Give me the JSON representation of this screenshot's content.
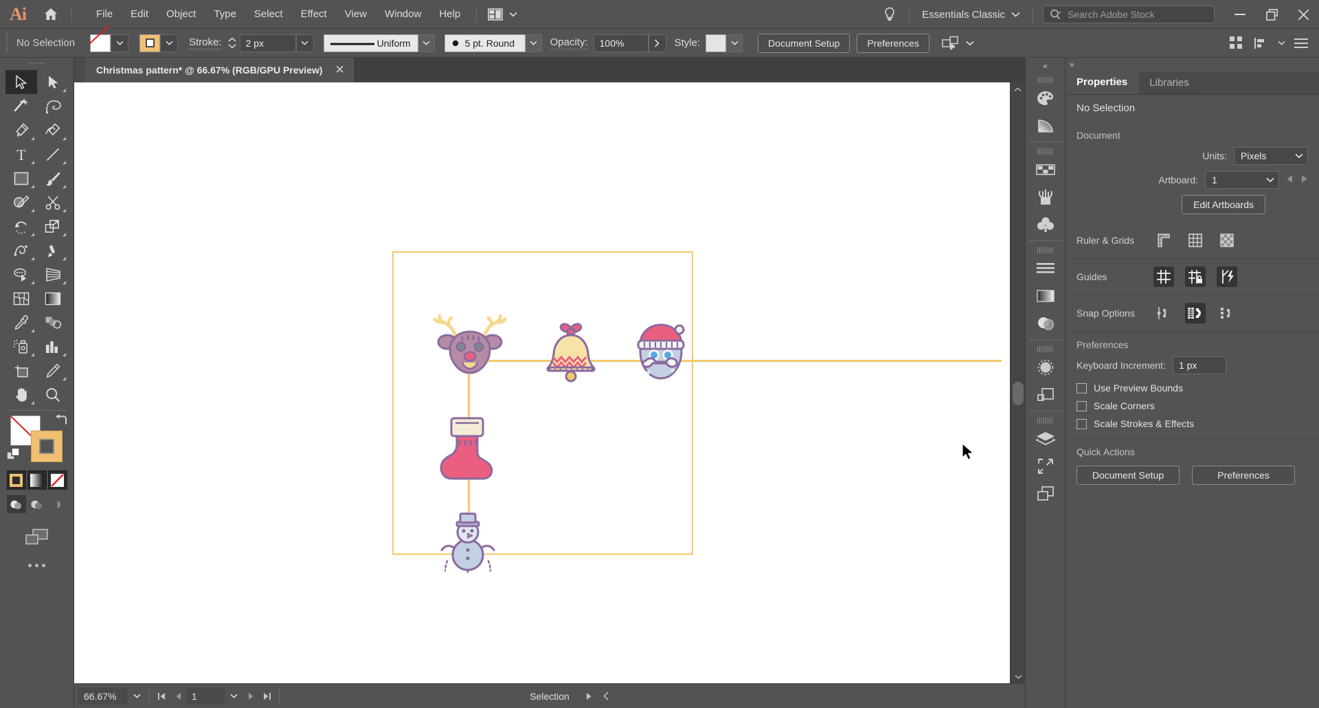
{
  "app": {
    "name": "Ai",
    "logo_color": "#e8956b"
  },
  "menubar": {
    "home_icon": "home-icon",
    "items": [
      "File",
      "Edit",
      "Object",
      "Type",
      "Select",
      "Effect",
      "View",
      "Window",
      "Help"
    ],
    "arrange_icon": "arrange-documents-icon",
    "bulb_icon": "discover-bulb-icon",
    "workspace": "Essentials Classic",
    "search": {
      "placeholder": "Search Adobe Stock",
      "value": "",
      "icon": "search-icon"
    },
    "window_controls": [
      "minimize",
      "restore",
      "close"
    ]
  },
  "controlbar": {
    "selection_status": "No Selection",
    "fill_swatch": "none-fill",
    "stroke_swatch": "#f0c070",
    "stroke_label": "Stroke:",
    "stroke_weight": "2 px",
    "stroke_profile": "Uniform",
    "brush_definition": "5 pt. Round",
    "opacity_label": "Opacity:",
    "opacity_value": "100%",
    "style_label": "Style:",
    "document_setup": "Document Setup",
    "preferences": "Preferences",
    "align_icon": "align-to-icon"
  },
  "toolbar": {
    "tools": [
      {
        "name": "selection-tool",
        "glyph": "selection",
        "active": true,
        "more": false
      },
      {
        "name": "direct-selection-tool",
        "glyph": "direct-selection",
        "active": false,
        "more": true
      },
      {
        "name": "magic-wand-tool",
        "glyph": "magic-wand",
        "active": false,
        "more": false
      },
      {
        "name": "lasso-tool",
        "glyph": "lasso",
        "active": false,
        "more": false
      },
      {
        "name": "pen-tool",
        "glyph": "pen",
        "active": false,
        "more": true
      },
      {
        "name": "curvature-tool",
        "glyph": "curvature",
        "active": false,
        "more": true
      },
      {
        "name": "type-tool",
        "glyph": "type",
        "active": false,
        "more": true
      },
      {
        "name": "line-segment-tool",
        "glyph": "line",
        "active": false,
        "more": true
      },
      {
        "name": "rectangle-tool",
        "glyph": "rectangle",
        "active": false,
        "more": true
      },
      {
        "name": "paintbrush-tool",
        "glyph": "paintbrush",
        "active": false,
        "more": true
      },
      {
        "name": "shaper-tool",
        "glyph": "shaper",
        "active": false,
        "more": true
      },
      {
        "name": "scissors-tool",
        "glyph": "scissors",
        "active": false,
        "more": true
      },
      {
        "name": "rotate-tool",
        "glyph": "rotate",
        "active": false,
        "more": true
      },
      {
        "name": "scale-tool",
        "glyph": "scale",
        "active": false,
        "more": true
      },
      {
        "name": "width-tool",
        "glyph": "width",
        "active": false,
        "more": true
      },
      {
        "name": "free-transform-tool",
        "glyph": "free-transform",
        "active": false,
        "more": true
      },
      {
        "name": "shape-builder-tool",
        "glyph": "shape-builder",
        "active": false,
        "more": true
      },
      {
        "name": "perspective-grid-tool",
        "glyph": "perspective-grid",
        "active": false,
        "more": true
      },
      {
        "name": "mesh-tool",
        "glyph": "mesh",
        "active": false,
        "more": false
      },
      {
        "name": "gradient-tool",
        "glyph": "gradient",
        "active": false,
        "more": false
      },
      {
        "name": "eyedropper-tool",
        "glyph": "eyedropper",
        "active": false,
        "more": true
      },
      {
        "name": "blend-tool",
        "glyph": "blend",
        "active": false,
        "more": false
      },
      {
        "name": "symbol-sprayer-tool",
        "glyph": "symbol-sprayer",
        "active": false,
        "more": true
      },
      {
        "name": "column-graph-tool",
        "glyph": "column-graph",
        "active": false,
        "more": true
      },
      {
        "name": "artboard-tool",
        "glyph": "artboard",
        "active": false,
        "more": false
      },
      {
        "name": "slice-tool",
        "glyph": "slice",
        "active": false,
        "more": true
      },
      {
        "name": "hand-tool",
        "glyph": "hand",
        "active": false,
        "more": true
      },
      {
        "name": "zoom-tool",
        "glyph": "zoom",
        "active": false,
        "more": false
      }
    ],
    "fill_color": "none",
    "stroke_color": "#f0c070",
    "swap_icon": "swap-fill-stroke-icon",
    "default_icon": "default-fill-stroke-icon",
    "color_modes": [
      "color-mode",
      "gradient-mode",
      "none-mode"
    ],
    "draw_modes": [
      "draw-normal",
      "draw-behind",
      "draw-inside"
    ],
    "screen_mode_icon": "change-screen-mode-icon",
    "edit_toolbar_icon": "edit-toolbar-icon"
  },
  "document": {
    "tab_title": "Christmas pattern* @ 66.67% (RGB/GPU Preview)",
    "close_icon": "close-tab-icon"
  },
  "canvas": {
    "artboard_border_color": "#f5c86a",
    "path_color": "#f5c86a",
    "artwork": [
      {
        "name": "reindeer-head",
        "label": "reindeer"
      },
      {
        "name": "christmas-bell",
        "label": "bell"
      },
      {
        "name": "santa-face",
        "label": "santa"
      },
      {
        "name": "christmas-stocking",
        "label": "stocking"
      },
      {
        "name": "snowman",
        "label": "snowman"
      }
    ],
    "cursor": "arrow-cursor"
  },
  "statusbar": {
    "zoom": "66.67%",
    "artboard_number": "1",
    "status_text": "Selection",
    "first_icon": "first-artboard-icon",
    "prev_icon": "previous-artboard-icon",
    "next_icon": "next-artboard-icon",
    "last_icon": "last-artboard-icon"
  },
  "icondock": {
    "groups": [
      [
        "color-palette-icon",
        "color-guide-icon"
      ],
      [
        "swatches-icon",
        "brushes-icon",
        "symbols-icon"
      ],
      [
        "stroke-lines-icon",
        "gradient-icon",
        "transparency-icon"
      ],
      [
        "appearance-icon",
        "graphic-styles-icon"
      ],
      [
        "layers-icon",
        "artboards-icon",
        "asset-export-icon"
      ]
    ]
  },
  "properties": {
    "tabs": [
      {
        "label": "Properties",
        "active": true
      },
      {
        "label": "Libraries",
        "active": false
      }
    ],
    "selection_status": "No Selection",
    "document": {
      "heading": "Document",
      "units_label": "Units:",
      "units_value": "Pixels",
      "artboard_label": "Artboard:",
      "artboard_value": "1",
      "edit_artboards": "Edit Artboards",
      "prev_icon": "previous-artboard-icon",
      "next_icon": "next-artboard-icon"
    },
    "ruler_grids": {
      "label": "Ruler & Grids",
      "icons": [
        "show-rulers-icon",
        "show-grid-icon",
        "show-transparency-grid-icon"
      ]
    },
    "guides": {
      "label": "Guides",
      "icons": [
        "show-guides-icon",
        "lock-guides-icon",
        "smart-guides-icon"
      ]
    },
    "snap_options": {
      "label": "Snap Options",
      "icons": [
        "snap-to-point-icon",
        "snap-to-grid-icon",
        "snap-to-pixel-icon"
      ],
      "active_index": 1
    },
    "preferences": {
      "heading": "Preferences",
      "keyboard_increment_label": "Keyboard Increment:",
      "keyboard_increment_value": "1 px",
      "checkboxes": [
        {
          "label": "Use Preview Bounds",
          "checked": false
        },
        {
          "label": "Scale Corners",
          "checked": false
        },
        {
          "label": "Scale Strokes & Effects",
          "checked": false
        }
      ]
    },
    "quick_actions": {
      "heading": "Quick Actions",
      "buttons": [
        "Document Setup",
        "Preferences"
      ]
    }
  }
}
